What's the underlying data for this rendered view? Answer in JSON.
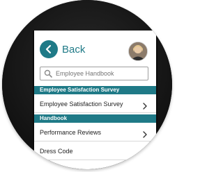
{
  "header": {
    "back_label": "Back"
  },
  "search": {
    "placeholder": "Employee Handbook"
  },
  "sections": [
    {
      "title": "Employee Satisfaction Survey",
      "items": [
        {
          "label": "Employee Satisfaction Survey"
        }
      ]
    },
    {
      "title": "Handbook",
      "items": [
        {
          "label": "Performance Reviews"
        },
        {
          "label": "Dress Code"
        }
      ]
    }
  ],
  "colors": {
    "accent": "#1f7a87",
    "phone_body": "#161616"
  },
  "icons": {
    "back": "arrow-left-icon",
    "search": "search-icon",
    "chevron": "chevron-right-icon"
  }
}
